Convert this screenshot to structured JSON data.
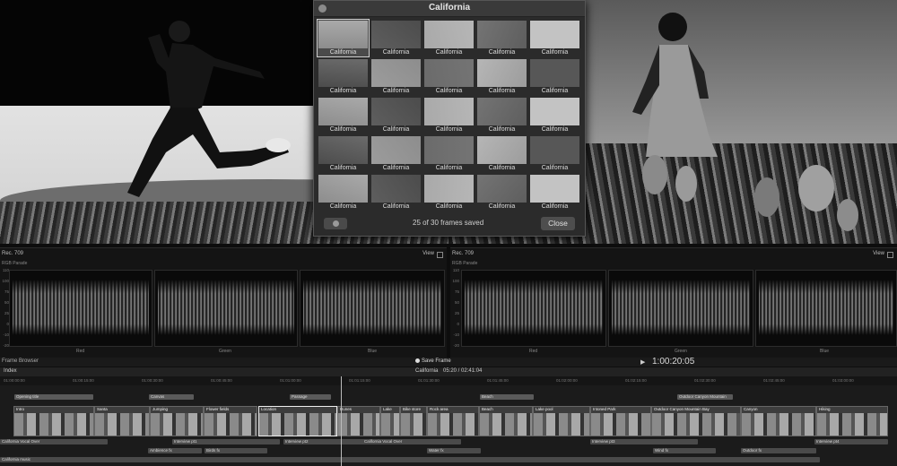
{
  "frame_browser": {
    "title": "California",
    "thumb_label": "California",
    "thumb_count": 25,
    "status": "25 of 30 frames saved",
    "close_label": "Close"
  },
  "scopes": {
    "left": {
      "standard": "Rec. 709",
      "type": "RGB Parade",
      "view_label": "View",
      "channels": [
        "Red",
        "Green",
        "Blue"
      ]
    },
    "right": {
      "standard": "Rec. 709",
      "type": "RGB Parade",
      "view_label": "View",
      "channels": [
        "Red",
        "Green",
        "Blue"
      ]
    },
    "scale": [
      "110",
      "100",
      "75",
      "50",
      "25",
      "0",
      "-10",
      "-20"
    ]
  },
  "transport": {
    "frame_browser_toggle": "Frame Browser",
    "save_frame_label": "Save Frame",
    "timecode": "1:00:20:05"
  },
  "timeline": {
    "index_label": "Index",
    "project_name": "California",
    "project_duration": "05:20 / 02:41:04",
    "ruler_ticks": [
      "01:00:00:00",
      "01:00:15:00",
      "01:00:30:00",
      "01:00:45:00",
      "01:01:00:00",
      "01:01:15:00",
      "01:01:30:00",
      "01:01:45:00",
      "01:02:00:00",
      "01:02:15:00",
      "01:02:30:00",
      "01:02:45:00",
      "01:03:00:00"
    ],
    "title_clips": [
      "Opening title",
      "Canvas",
      "Passage",
      "Beach",
      "Outdoor Canyon Mountain"
    ],
    "video_clips": [
      "Intro",
      "Santa",
      "Jumping",
      "Flower fields",
      "Location",
      "Dunes",
      "Lake",
      "Bike store",
      "Rock area",
      "Beach",
      "Lake pool",
      "Intoned Park",
      "Outdoor Canyon Mountain Bay",
      "Canyon",
      "Hiking"
    ],
    "audio_clips": [
      "California Vocal Over",
      "Interview pt1",
      "Interview pt2",
      "California Vocal Over",
      "Interview pt3",
      "Interview pt4",
      "Ambience fx",
      "Birds fx",
      "Water fx",
      "Wind fx",
      "Outdoor fx",
      "California music"
    ]
  }
}
